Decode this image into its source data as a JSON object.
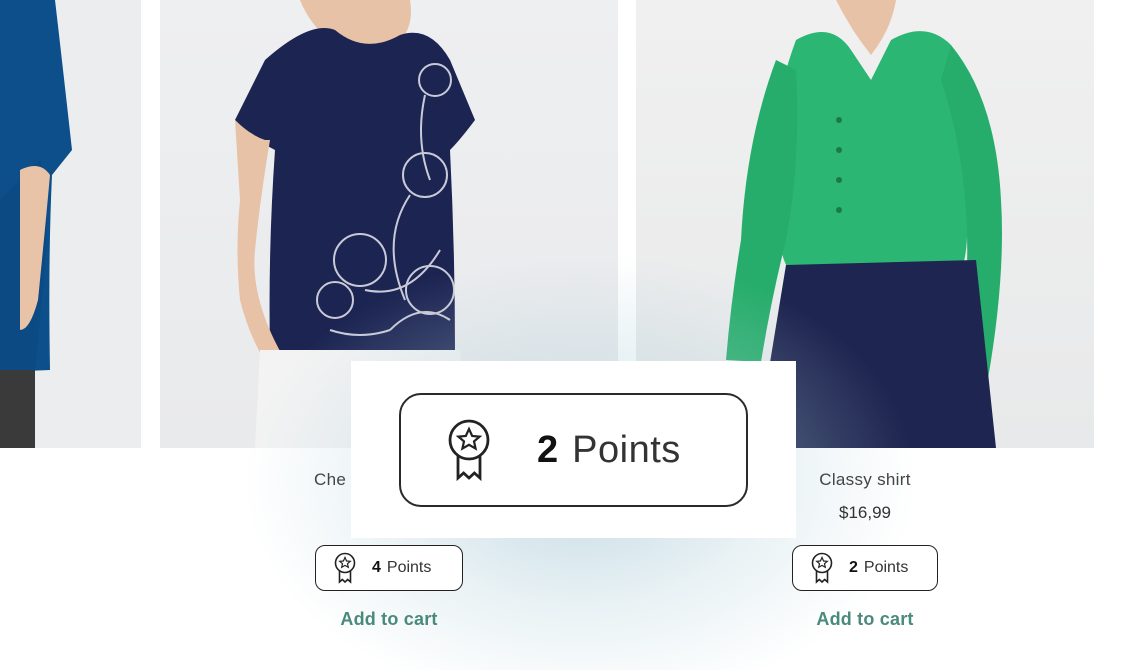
{
  "products": [
    {
      "name": "Che",
      "price": "",
      "points_value": "4",
      "points_label": "Points",
      "add_to_cart_label": "Add to cart"
    },
    {
      "name": "Classy shirt",
      "price": "$16,99",
      "points_value": "2",
      "points_label": "Points",
      "add_to_cart_label": "Add to cart"
    }
  ],
  "zoom_callout": {
    "points_value": "2",
    "points_label": "Points"
  },
  "colors": {
    "accent_link": "#4a8a7c",
    "badge_border": "#222222",
    "navy_shirt": "#1c2452",
    "blue_shirt": "#0c4f8a",
    "green_shirt": "#2bb673"
  },
  "icons": {
    "points_badge": "medal-icon"
  }
}
